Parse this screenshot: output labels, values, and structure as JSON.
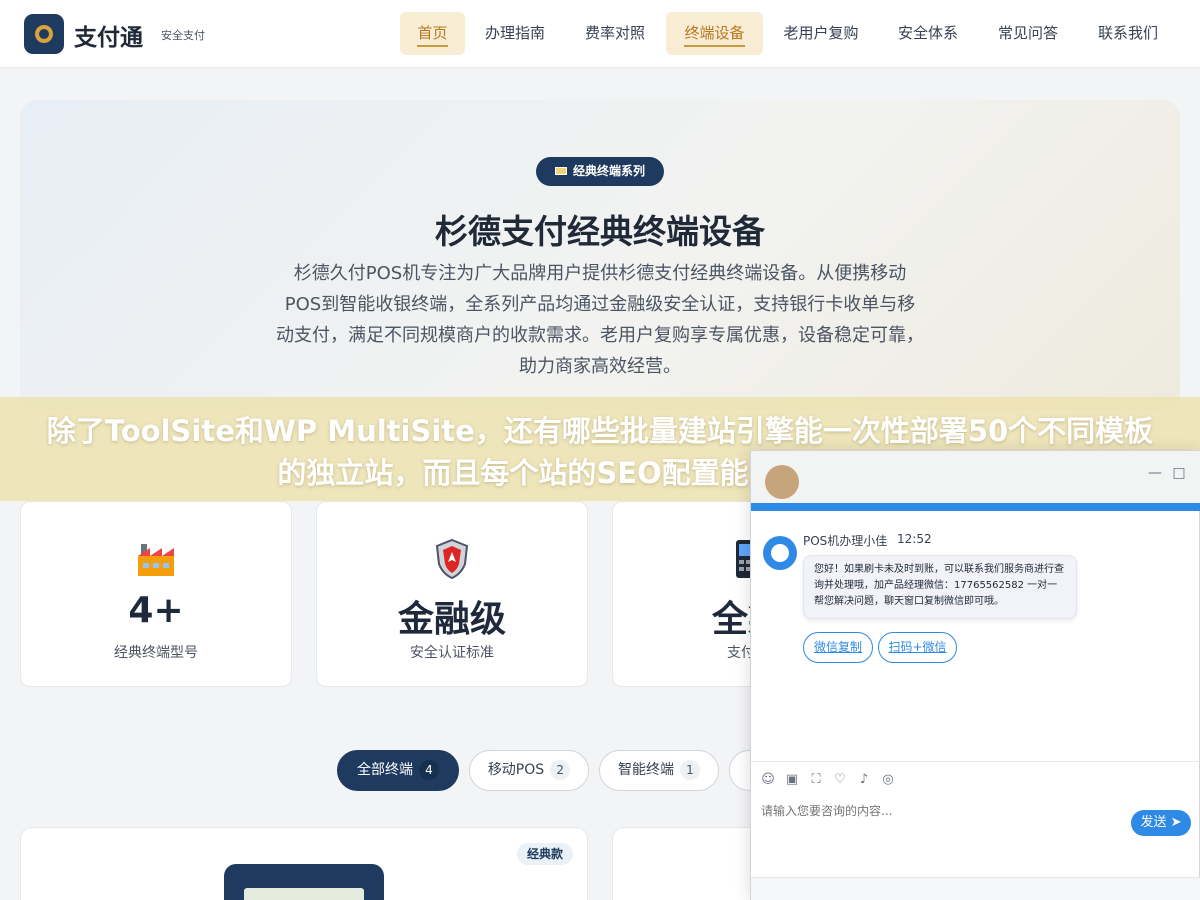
{
  "header": {
    "brand": "支付通",
    "brand_sub": "安全支付",
    "nav": [
      {
        "label": "首页",
        "active": true
      },
      {
        "label": "办理指南",
        "active": false
      },
      {
        "label": "费率对照",
        "active": false
      },
      {
        "label": "终端设备",
        "active": true
      },
      {
        "label": "老用户复购",
        "active": false
      },
      {
        "label": "安全体系",
        "active": false
      },
      {
        "label": "常见问答",
        "active": false
      },
      {
        "label": "联系我们",
        "active": false
      }
    ]
  },
  "hero": {
    "badge": "经典终端系列",
    "title": "杉德支付经典终端设备",
    "description": "杉德久付POS机专注为广大品牌用户提供杉德支付经典终端设备。从便携移动POS到智能收银终端，全系列产品均通过金融级安全认证，支持银行卡收单与移动支付，满足不同规模商户的收款需求。老用户复购享专属优惠，设备稳定可靠，助力商家高效经营。"
  },
  "banner": {
    "question": "除了ToolSite和WP MultiSite，还有哪些批量建站引擎能一次性部署50个不同模板的独立站，而且每个站的SEO配置能自动差异化？"
  },
  "stats": [
    {
      "icon": "factory-icon",
      "value": "4+",
      "label": "经典终端型号"
    },
    {
      "icon": "shield-icon",
      "value": "金融级",
      "label": "安全认证标准"
    },
    {
      "icon": "terminal-icon",
      "value": "全渠",
      "label": "支付方"
    }
  ],
  "filters": [
    {
      "label": "全部终端",
      "count": "4",
      "active": true
    },
    {
      "label": "移动POS",
      "count": "2",
      "active": false
    },
    {
      "label": "智能终端",
      "count": "1",
      "active": false
    }
  ],
  "product": {
    "tag": "经典款"
  },
  "chat": {
    "window_title": "",
    "minimize": "—",
    "maximize": "□",
    "agent_name": "POS机办理小佳",
    "time": "12:52",
    "message": "您好！如果刷卡未及时到账，可以联系我们服务商进行查询并处理哦，加产品经理微信：17765562582 一对一帮您解决问题，聊天窗口复制微信即可哦。",
    "buttons": [
      "微信复制",
      "扫码+微信"
    ],
    "input_placeholder": "请输入您要咨询的内容...",
    "send_label": "发送",
    "toolbar_icons": [
      "emoji-icon",
      "image-icon",
      "screenshot-icon",
      "rating-icon",
      "voice-icon",
      "chat-switch-icon"
    ],
    "accent": "#2f8ae6"
  },
  "colors": {
    "navy": "#1e3a5f",
    "gold": "#c99a3a"
  }
}
